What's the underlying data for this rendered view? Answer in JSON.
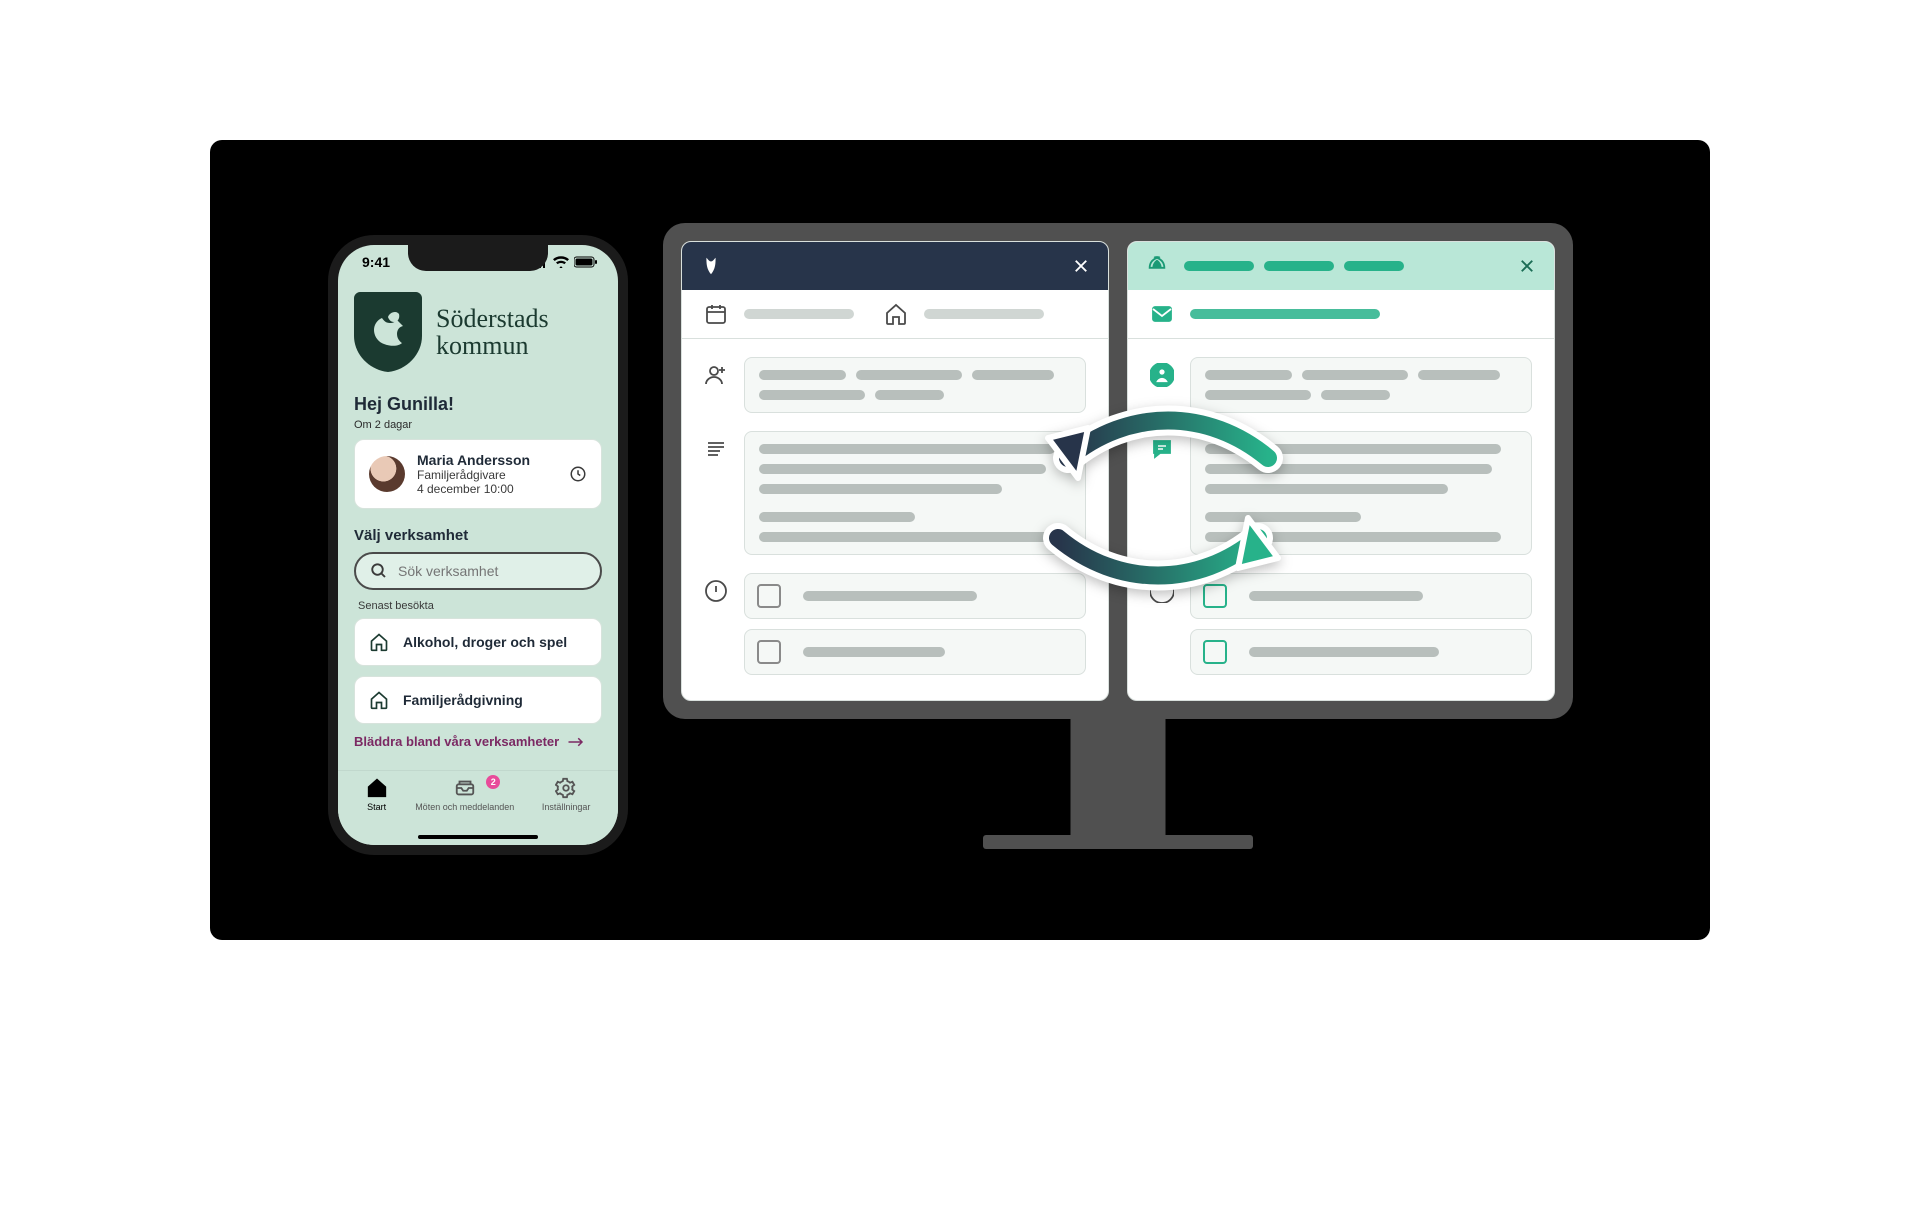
{
  "phone": {
    "status_time": "9:41",
    "brand_line1": "Söderstads",
    "brand_line2": "kommun",
    "greeting": "Hej Gunilla!",
    "subtitle": "Om 2 dagar",
    "appointment": {
      "name": "Maria Andersson",
      "role": "Familjerådgivare",
      "datetime": "4 december 10:00"
    },
    "choose_label": "Välj verksamhet",
    "search_placeholder": "Sök verksamhet",
    "recent_label": "Senast besökta",
    "recent_items": [
      "Alkohol, droger och spel",
      "Familjerådgivning"
    ],
    "browse_label": "Bläddra bland våra verksamheter",
    "tabs": {
      "start": "Start",
      "meetings": "Möten och meddelanden",
      "settings": "Inställningar",
      "badge_count": "2"
    }
  },
  "colors": {
    "teal": "#27b28a",
    "navy": "#27344a",
    "mint": "#cce4d8"
  }
}
